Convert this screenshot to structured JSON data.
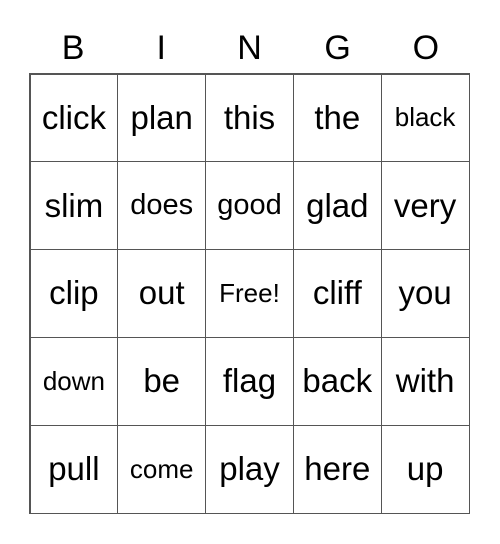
{
  "header": [
    "B",
    "I",
    "N",
    "G",
    "O"
  ],
  "cells": [
    [
      "click",
      "plan",
      "this",
      "the",
      "black"
    ],
    [
      "slim",
      "does",
      "good",
      "glad",
      "very"
    ],
    [
      "clip",
      "out",
      "Free!",
      "cliff",
      "you"
    ],
    [
      "down",
      "be",
      "flag",
      "back",
      "with"
    ],
    [
      "pull",
      "come",
      "play",
      "here",
      "up"
    ]
  ]
}
